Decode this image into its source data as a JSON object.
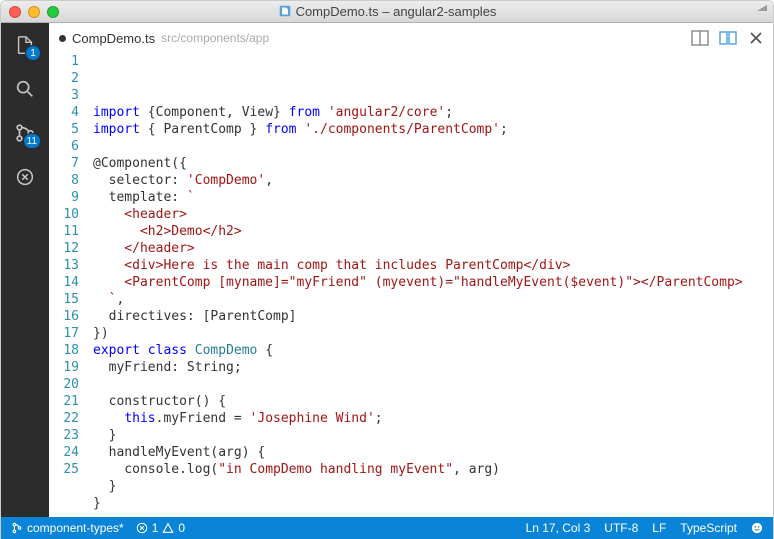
{
  "window": {
    "title": "CompDemo.ts – angular2-samples"
  },
  "activitybar": {
    "explorer_badge": "1",
    "git_badge": "11"
  },
  "tab": {
    "name": "CompDemo.ts",
    "path": "src/components/app"
  },
  "code": {
    "lines": [
      {
        "n": 1,
        "segs": [
          [
            "kw",
            "import"
          ],
          [
            "punct",
            " {Component, View} "
          ],
          [
            "kw",
            "from"
          ],
          [
            "punct",
            " "
          ],
          [
            "str",
            "'angular2/core'"
          ],
          [
            "punct",
            ";"
          ]
        ]
      },
      {
        "n": 2,
        "segs": [
          [
            "kw",
            "import"
          ],
          [
            "punct",
            " { ParentComp } "
          ],
          [
            "kw",
            "from"
          ],
          [
            "punct",
            " "
          ],
          [
            "str",
            "'./components/ParentComp'"
          ],
          [
            "punct",
            ";"
          ]
        ]
      },
      {
        "n": 3,
        "segs": [
          [
            "punct",
            ""
          ]
        ]
      },
      {
        "n": 4,
        "segs": [
          [
            "dec",
            "@Component({"
          ]
        ]
      },
      {
        "n": 5,
        "segs": [
          [
            "punct",
            "  selector: "
          ],
          [
            "str",
            "'CompDemo'"
          ],
          [
            "punct",
            ","
          ]
        ]
      },
      {
        "n": 6,
        "segs": [
          [
            "punct",
            "  template: "
          ],
          [
            "str",
            "`"
          ]
        ]
      },
      {
        "n": 7,
        "segs": [
          [
            "str",
            "    <header>"
          ]
        ]
      },
      {
        "n": 8,
        "segs": [
          [
            "str",
            "      <h2>Demo</h2>"
          ]
        ]
      },
      {
        "n": 9,
        "segs": [
          [
            "str",
            "    </header>"
          ]
        ]
      },
      {
        "n": 10,
        "segs": [
          [
            "str",
            "    <div>Here is the main comp that includes ParentComp</div>"
          ]
        ]
      },
      {
        "n": 11,
        "segs": [
          [
            "str",
            "    <ParentComp [myname]=\"myFriend\" (myevent)=\"handleMyEvent($event)\"></ParentComp>"
          ]
        ]
      },
      {
        "n": 12,
        "segs": [
          [
            "str",
            "  `"
          ],
          [
            "punct",
            ","
          ]
        ]
      },
      {
        "n": 13,
        "segs": [
          [
            "punct",
            "  directives: [ParentComp]"
          ]
        ]
      },
      {
        "n": 14,
        "segs": [
          [
            "punct",
            "})"
          ]
        ]
      },
      {
        "n": 15,
        "segs": [
          [
            "kw",
            "export"
          ],
          [
            "punct",
            " "
          ],
          [
            "kw",
            "class"
          ],
          [
            "punct",
            " "
          ],
          [
            "type",
            "CompDemo"
          ],
          [
            "punct",
            " {"
          ]
        ]
      },
      {
        "n": 16,
        "segs": [
          [
            "punct",
            "  myFriend: String;"
          ]
        ]
      },
      {
        "n": 17,
        "segs": [
          [
            "punct",
            "  "
          ]
        ]
      },
      {
        "n": 18,
        "segs": [
          [
            "punct",
            "  constructor() {"
          ]
        ]
      },
      {
        "n": 19,
        "segs": [
          [
            "punct",
            "    "
          ],
          [
            "kw2",
            "this"
          ],
          [
            "punct",
            ".myFriend = "
          ],
          [
            "str",
            "'Josephine Wind'"
          ],
          [
            "punct",
            ";"
          ]
        ]
      },
      {
        "n": 20,
        "segs": [
          [
            "punct",
            "  }"
          ]
        ]
      },
      {
        "n": 21,
        "segs": [
          [
            "punct",
            "  handleMyEvent("
          ],
          [
            "prop",
            "arg"
          ],
          [
            "punct",
            ") {"
          ]
        ]
      },
      {
        "n": 22,
        "segs": [
          [
            "punct",
            "    console.log("
          ],
          [
            "str",
            "\"in CompDemo handling myEvent\""
          ],
          [
            "punct",
            ", arg)"
          ]
        ]
      },
      {
        "n": 23,
        "segs": [
          [
            "punct",
            "  }"
          ]
        ]
      },
      {
        "n": 24,
        "segs": [
          [
            "punct",
            "}"
          ]
        ]
      },
      {
        "n": 25,
        "segs": [
          [
            "punct",
            ""
          ]
        ]
      }
    ],
    "current_line_index": 16
  },
  "status": {
    "branch": "component-types*",
    "errors": "1",
    "warnings": "0",
    "cursor": "Ln 17, Col 3",
    "encoding": "UTF-8",
    "eol": "LF",
    "language": "TypeScript"
  }
}
